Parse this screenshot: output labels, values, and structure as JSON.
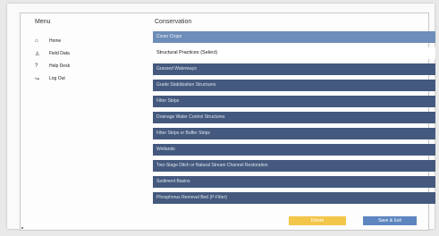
{
  "sidebar": {
    "title": "Menu",
    "items": [
      {
        "label": "Home",
        "icon": "home-icon",
        "glyph": "⌂"
      },
      {
        "label": "Field Data",
        "icon": "person-icon",
        "glyph": "♙"
      },
      {
        "label": "Help Desk",
        "icon": "question-icon",
        "glyph": "?"
      },
      {
        "label": "Log Out",
        "icon": "logout-icon",
        "glyph": "↪"
      }
    ]
  },
  "content": {
    "title": "Conservation",
    "items": [
      {
        "label": "Cover Crops",
        "style": "selected"
      },
      {
        "label": "Structural Practices (Select)",
        "style": "plain"
      },
      {
        "label": "Grassed Waterways",
        "style": "bar"
      },
      {
        "label": "Grade Stabilization Structures",
        "style": "bar"
      },
      {
        "label": "Filter Strips",
        "style": "bar"
      },
      {
        "label": "Drainage Water Control Structures",
        "style": "bar"
      },
      {
        "label": "Filter Strips or Buffer Strips",
        "style": "bar"
      },
      {
        "label": "Wetlands",
        "style": "bar"
      },
      {
        "label": "Two-Stage Ditch or Natural Stream Channel Restoration",
        "style": "bar"
      },
      {
        "label": "Sediment Basins",
        "style": "bar"
      },
      {
        "label": "Phosphorus Removal Bed (P-Filter)",
        "style": "bar"
      }
    ]
  },
  "footer": {
    "left_button": "Delete",
    "right_button": "Save & Exit"
  },
  "colors": {
    "bar": "#44597d",
    "selected": "#6e8db9",
    "yellow_button": "#f3c64a",
    "blue_button": "#5d86c0"
  }
}
